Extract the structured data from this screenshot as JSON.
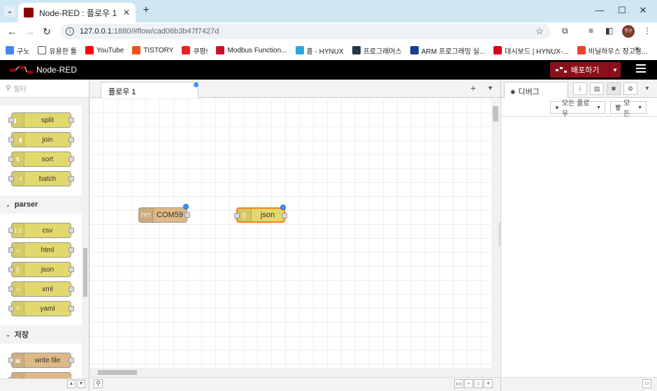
{
  "browser": {
    "tab_title": "Node-RED : 플로우 1",
    "url_host": "127.0.0.1",
    "url_path": ":1880/#flow/cad06b3b47f7427d",
    "profile_initials": "항규",
    "bookmarks": [
      {
        "label": "구노",
        "color": "#4285f4"
      },
      {
        "label": "유용한 툴",
        "color": "#ffffff"
      },
      {
        "label": "YouTube",
        "color": "#ff0000"
      },
      {
        "label": "TISTORY",
        "color": "#eb531f"
      },
      {
        "label": "쿠팡!",
        "color": "#e52528"
      },
      {
        "label": "Modbus Function...",
        "color": "#c8102e"
      },
      {
        "label": "홈 - HYNUX",
        "color": "#2aa7e0"
      },
      {
        "label": "프로그래머스",
        "color": "#263747"
      },
      {
        "label": "ARM 프로그래밍 실...",
        "color": "#1a3c8f"
      },
      {
        "label": "대시보드 | HYNUX-...",
        "color": "#d6001c"
      },
      {
        "label": "비닐하우스 장고용...",
        "color": "#e94235"
      }
    ]
  },
  "app": {
    "name": "Node-RED",
    "deploy_label": "배포하기"
  },
  "palette": {
    "search_placeholder": "필터",
    "categories": [
      "parser",
      "저장"
    ],
    "nodes_sequence": [
      "split",
      "join",
      "sort",
      "batch"
    ],
    "nodes_parser": [
      "csv",
      "html",
      "json",
      "xml",
      "yaml"
    ],
    "nodes_storage": [
      "write file"
    ]
  },
  "workspace": {
    "tab_label": "플로우 1",
    "nodes": [
      {
        "label": "COM59",
        "type": "serial in",
        "color": "#deb887"
      },
      {
        "label": "json",
        "type": "json",
        "color": "#e2d96e"
      }
    ]
  },
  "sidebar": {
    "tab_label": "디버그",
    "filter_label": "모든 플로우",
    "clear_label": "모든"
  }
}
